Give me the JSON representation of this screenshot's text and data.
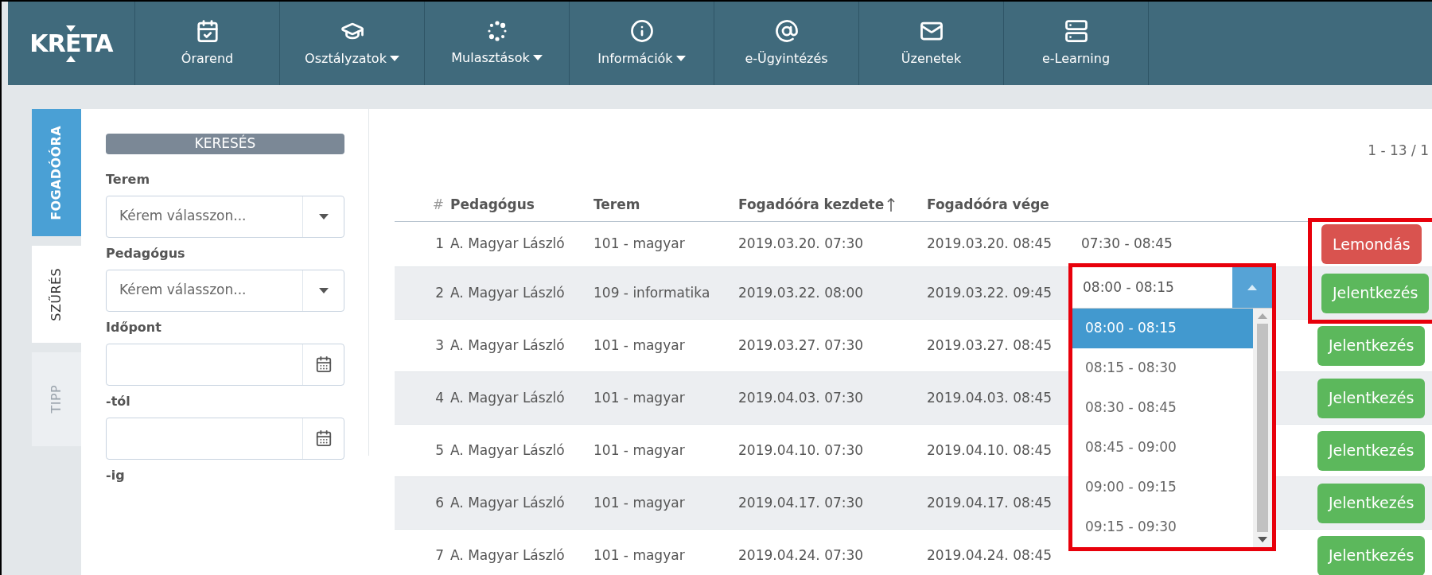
{
  "nav": {
    "logo": "KRETA",
    "items": [
      {
        "label": "Órarend",
        "kind": "calendar",
        "caret": false
      },
      {
        "label": "Osztályzatok",
        "kind": "cap",
        "caret": true
      },
      {
        "label": "Mulasztások",
        "kind": "dots",
        "caret": true
      },
      {
        "label": "Információk",
        "kind": "info",
        "caret": true
      },
      {
        "label": "e-Ügyintézés",
        "kind": "at",
        "caret": false
      },
      {
        "label": "Üzenetek",
        "kind": "mail",
        "caret": false
      },
      {
        "label": "e-Learning",
        "kind": "server",
        "caret": false
      }
    ]
  },
  "side_tabs": [
    {
      "label": "FOGADÓÓRA",
      "selected": true,
      "disabled": false
    },
    {
      "label": "SZŰRÉS",
      "selected": false,
      "disabled": false
    },
    {
      "label": "TIPP",
      "selected": false,
      "disabled": true
    }
  ],
  "filter": {
    "search_button": "KERESÉS",
    "fields": [
      {
        "label": "Terem",
        "kind": "select",
        "placeholder": "Kérem válasszon..."
      },
      {
        "label": "Pedagógus",
        "kind": "select",
        "placeholder": "Kérem válasszon..."
      },
      {
        "label": "Időpont",
        "kind": "date"
      },
      {
        "label": "-tól",
        "kind": "date"
      },
      {
        "label": "-ig",
        "kind": "none"
      }
    ]
  },
  "pagination": "1 - 13 / 1",
  "table": {
    "columns": [
      {
        "label": "#",
        "sorted": false
      },
      {
        "label": "Pedagógus",
        "sorted": false
      },
      {
        "label": "Terem",
        "sorted": false
      },
      {
        "label": "Fogadóóra kezdete",
        "sorted": true
      },
      {
        "label": "Fogadóóra vége",
        "sorted": false
      }
    ],
    "rows": [
      {
        "num": "1",
        "teacher": "A. Magyar László",
        "room": "101 - magyar",
        "start": "2019.03.20. 07:30",
        "end": "2019.03.20. 08:45",
        "slot": {
          "kind": "text",
          "text": "07:30 - 08:45"
        },
        "action": {
          "kind": "cancel",
          "label": "Lemondás",
          "highlighted": true
        }
      },
      {
        "num": "2",
        "teacher": "A. Magyar László",
        "room": "109 - informatika",
        "start": "2019.03.22. 08:00",
        "end": "2019.03.22. 09:45",
        "slot": {
          "kind": "select",
          "value": "08:00 - 08:15",
          "expanded": true,
          "highlighted": true,
          "options": [
            {
              "label": "08:00 - 08:15",
              "selected": true
            },
            {
              "label": "08:15 - 08:30",
              "selected": false
            },
            {
              "label": "08:30 - 08:45",
              "selected": false
            },
            {
              "label": "08:45 - 09:00",
              "selected": false
            },
            {
              "label": "09:00 - 09:15",
              "selected": false
            },
            {
              "label": "09:15 - 09:30",
              "selected": false
            }
          ]
        },
        "action": {
          "kind": "apply",
          "label": "Jelentkezés",
          "highlighted": true
        }
      },
      {
        "num": "3",
        "teacher": "A. Magyar László",
        "room": "101 - magyar",
        "start": "2019.03.27. 07:30",
        "end": "2019.03.27. 08:45",
        "action": {
          "kind": "apply",
          "label": "Jelentkezés",
          "highlighted": false
        }
      },
      {
        "num": "4",
        "teacher": "A. Magyar László",
        "room": "101 - magyar",
        "start": "2019.04.03. 07:30",
        "end": "2019.04.03. 08:45",
        "action": {
          "kind": "apply",
          "label": "Jelentkezés",
          "highlighted": false
        }
      },
      {
        "num": "5",
        "teacher": "A. Magyar László",
        "room": "101 - magyar",
        "start": "2019.04.10. 07:30",
        "end": "2019.04.10. 08:45",
        "action": {
          "kind": "apply",
          "label": "Jelentkezés",
          "highlighted": false
        }
      },
      {
        "num": "6",
        "teacher": "A. Magyar László",
        "room": "101 - magyar",
        "start": "2019.04.17. 07:30",
        "end": "2019.04.17. 08:45",
        "action": {
          "kind": "apply",
          "label": "Jelentkezés",
          "highlighted": false
        }
      },
      {
        "num": "7",
        "teacher": "A. Magyar László",
        "room": "101 - magyar",
        "start": "2019.04.24. 07:30",
        "end": "2019.04.24. 08:45",
        "action": {
          "kind": "apply",
          "label": "Jelentkezés",
          "highlighted": false
        }
      }
    ]
  }
}
